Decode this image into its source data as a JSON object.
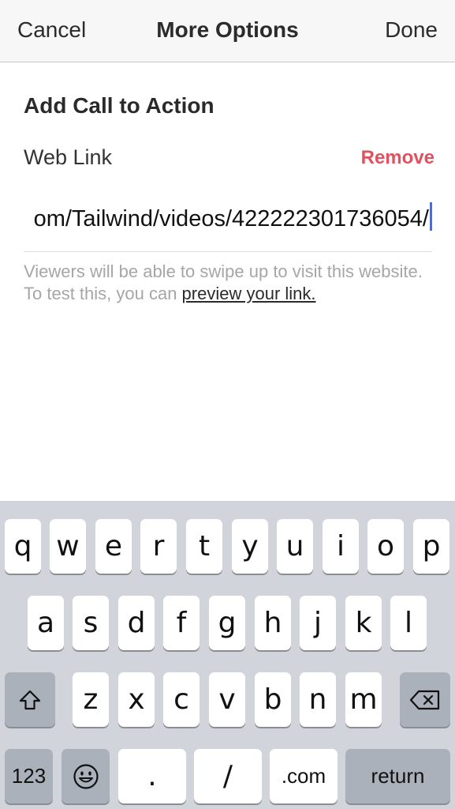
{
  "nav": {
    "cancel_label": "Cancel",
    "title": "More Options",
    "done_label": "Done"
  },
  "content": {
    "section_title": "Add Call to Action",
    "web_link_label": "Web Link",
    "remove_label": "Remove",
    "url_value": "om/Tailwind/videos/422222301736054/",
    "help_text": "Viewers will be able to swipe up to visit this website. To test this, you can ",
    "help_link": "preview your link."
  },
  "keyboard": {
    "row1": [
      "q",
      "w",
      "e",
      "r",
      "t",
      "y",
      "u",
      "i",
      "o",
      "p"
    ],
    "row2": [
      "a",
      "s",
      "d",
      "f",
      "g",
      "h",
      "j",
      "k",
      "l"
    ],
    "row3": [
      "z",
      "x",
      "c",
      "v",
      "b",
      "n",
      "m"
    ],
    "numbers_label": "123",
    "period_label": ".",
    "slash_label": "/",
    "dotcom_label": ".com",
    "return_label": "return",
    "shift_icon": "shift-icon",
    "backspace_icon": "backspace-icon",
    "emoji_icon": "emoji-icon"
  },
  "colors": {
    "remove": "#e0525f",
    "caret": "#3d6ff1",
    "keyboard_bg": "#d1d4da",
    "key_dark": "#abb1ba"
  }
}
